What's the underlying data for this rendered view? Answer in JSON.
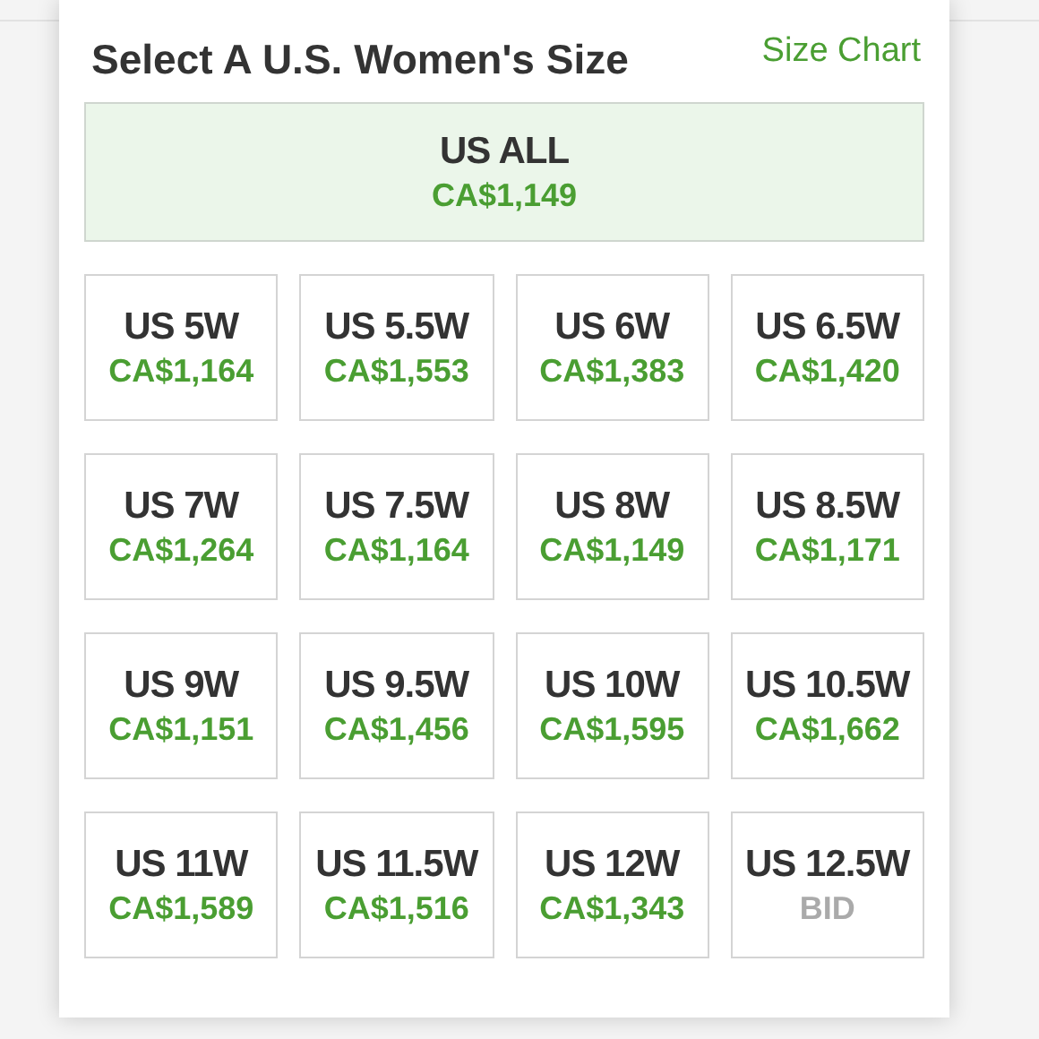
{
  "header": {
    "title": "Select A U.S. Women's Size",
    "link": "Size Chart"
  },
  "all_sizes": {
    "size": "US ALL",
    "price": "CA$1,149",
    "kind": "price",
    "selected": true
  },
  "sizes": [
    {
      "size": "US 5W",
      "price": "CA$1,164",
      "kind": "price",
      "selected": false
    },
    {
      "size": "US 5.5W",
      "price": "CA$1,553",
      "kind": "price",
      "selected": false
    },
    {
      "size": "US 6W",
      "price": "CA$1,383",
      "kind": "price",
      "selected": false
    },
    {
      "size": "US 6.5W",
      "price": "CA$1,420",
      "kind": "price",
      "selected": false
    },
    {
      "size": "US 7W",
      "price": "CA$1,264",
      "kind": "price",
      "selected": false
    },
    {
      "size": "US 7.5W",
      "price": "CA$1,164",
      "kind": "price",
      "selected": false
    },
    {
      "size": "US 8W",
      "price": "CA$1,149",
      "kind": "price",
      "selected": false
    },
    {
      "size": "US 8.5W",
      "price": "CA$1,171",
      "kind": "price",
      "selected": false
    },
    {
      "size": "US 9W",
      "price": "CA$1,151",
      "kind": "price",
      "selected": false
    },
    {
      "size": "US 9.5W",
      "price": "CA$1,456",
      "kind": "price",
      "selected": false
    },
    {
      "size": "US 10W",
      "price": "CA$1,595",
      "kind": "price",
      "selected": false
    },
    {
      "size": "US 10.5W",
      "price": "CA$1,662",
      "kind": "price",
      "selected": false
    },
    {
      "size": "US 11W",
      "price": "CA$1,589",
      "kind": "price",
      "selected": false
    },
    {
      "size": "US 11.5W",
      "price": "CA$1,516",
      "kind": "price",
      "selected": false
    },
    {
      "size": "US 12W",
      "price": "CA$1,343",
      "kind": "price",
      "selected": false
    },
    {
      "size": "US 12.5W",
      "price": "BID",
      "kind": "bid",
      "selected": false
    }
  ]
}
